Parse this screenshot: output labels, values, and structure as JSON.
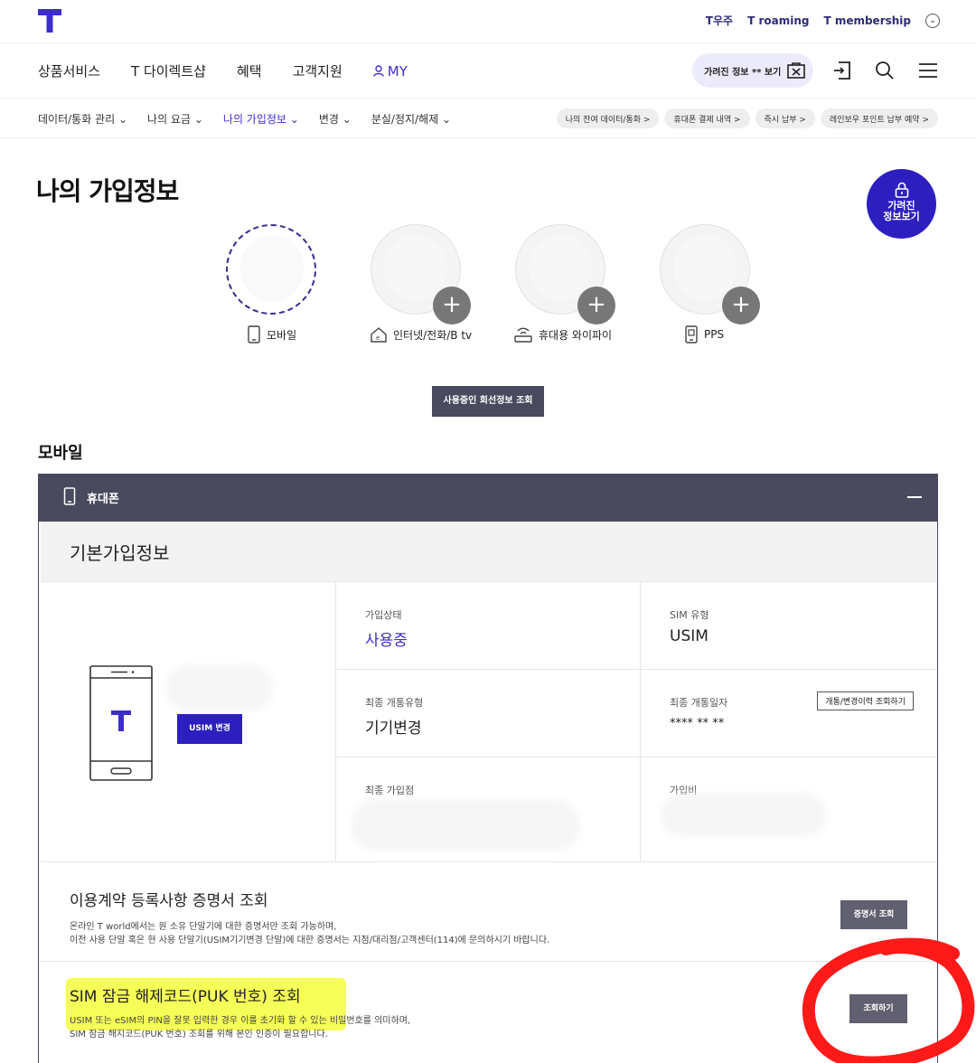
{
  "topbar": {
    "links": [
      "T우주",
      "T roaming",
      "T membership"
    ]
  },
  "mainnav": {
    "items": [
      "상품서비스",
      "T 다이렉트샵",
      "혜택",
      "고객지원"
    ],
    "my": "MY",
    "hidden_info": "가려진 정보 ** 보기"
  },
  "subnav": {
    "items": [
      "데이터/통화 관리",
      "나의 요금",
      "나의 가입정보",
      "변경",
      "분실/정지/해제"
    ],
    "pills": [
      "나의 잔여 데이터/통화 >",
      "휴대폰 결제 내역 >",
      "즉시 납부 >",
      "레인보우 포인트 납부 예약 >"
    ]
  },
  "page": {
    "title": "나의 가입정보",
    "fab": [
      "가려진",
      "정보보기"
    ]
  },
  "services": [
    {
      "label": "모바일",
      "icon": "mobile-icon"
    },
    {
      "label": "인터넷/전화/B tv",
      "icon": "home-icon"
    },
    {
      "label": "휴대용 와이파이",
      "icon": "wifi-router-icon"
    },
    {
      "label": "PPS",
      "icon": "pps-icon"
    }
  ],
  "line_info_btn": "사용중인 회선정보 조회",
  "section": {
    "title": "모바일",
    "panel_label": "휴대폰",
    "basic_title": "기본가입정보",
    "usim_btn": "USIM 변경",
    "fields": {
      "status_k": "가입상태",
      "status_v": "사용중",
      "sim_k": "SIM 유형",
      "sim_v": "USIM",
      "last_type_k": "최종 개통유형",
      "last_type_v": "기기변경",
      "last_date_k": "최종 개통일자",
      "last_date_v": "**** ** **",
      "history_btn": "개통/변경이력 조회하기",
      "shop_k": "최종 가입점",
      "fee_k": "가입비"
    },
    "cert": {
      "title": "이용계약 등록사항 증명서 조회",
      "desc1": "온라인 T world에서는 원 소유 단말기에 대한 증명서만 조회 가능하며,",
      "desc2": "이전 사용 단말 혹은 현 사용 단말기(USIM기기변경 단말)에 대한 증명서는 지점/대리점/고객센터(114)에 문의하시기 바랍니다.",
      "btn": "증명서 조회"
    },
    "puk": {
      "title": "SIM 잠금 해제코드(PUK 번호) 조회",
      "desc1": "USIM 또는 eSIM의 PIN을 잘못 입력한 경우 이를 초기화 할 수 있는 비밀번호를 의미하며,",
      "desc2": "SIM 잠금 해지코드(PUK 번호) 조회를 위해 본인 인증이 필요합니다.",
      "btn": "조회하기"
    }
  },
  "colors": {
    "brand": "#3d2ec7",
    "panel": "#4a4a5e",
    "highlight": "#f4ff3a",
    "annotation": "#ff1a1a"
  }
}
